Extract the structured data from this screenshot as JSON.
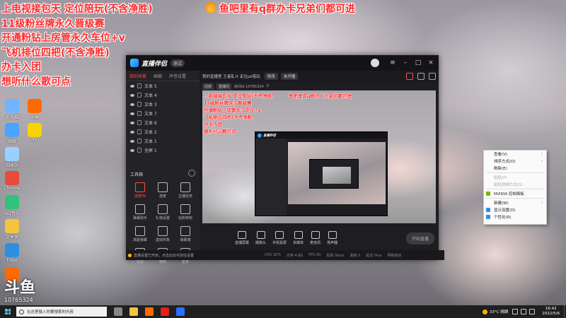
{
  "overlay": {
    "left_lines": [
      "上电视接包天 定位陪玩(不含净胜)",
      "11级粉丝牌永久晋级赛",
      "开通粉钻上房管永久车位+v",
      "飞机排位四把(不含净胜)",
      "办卡入团",
      "想听什么歌可点"
    ],
    "right_line": "鱼吧里有q群办卡兄弟们都可进"
  },
  "desktop_icons": [
    {
      "label": "此电脑",
      "color": "#6fb4ff"
    },
    {
      "label": "网络",
      "color": "#4aa3ff"
    },
    {
      "label": "回收站",
      "color": "#9ad0ff"
    },
    {
      "label": "Chrome",
      "color": "#e84b3c"
    },
    {
      "label": "QQ音乐",
      "color": "#31c27c"
    },
    {
      "label": "文件夹",
      "color": "#f5c342"
    },
    {
      "label": "Edge",
      "color": "#2f8ee0"
    },
    {
      "label": "直播",
      "color": "#ff6a00"
    }
  ],
  "desktop_icons_right": [
    {
      "label": "斗鱼",
      "color": "#ff6a00"
    },
    {
      "label": "YY",
      "color": "#f7d300"
    }
  ],
  "logo_badge": {
    "big": "斗鱼",
    "number": "10765324"
  },
  "app": {
    "name": "直播伴侣",
    "version": "测试",
    "left_tabs": [
      "我的场景",
      "画面",
      "声音设置"
    ],
    "scenes": [
      "文本 5",
      "文本 4",
      "文本 3",
      "文本 7",
      "文本 6",
      "文本 2",
      "文本 1",
      "全屏 1"
    ],
    "tools_heading": "工具箱",
    "tools": [
      {
        "label": "连麦PK",
        "red": true
      },
      {
        "label": "连麦",
        "red": false
      },
      {
        "label": "主播任务",
        "red": false
      },
      {
        "label": "弹幕助手",
        "red": false
      },
      {
        "label": "礼物设置",
        "red": false
      },
      {
        "label": "钻粉特权",
        "red": false
      },
      {
        "label": "高能弹幕",
        "red": false
      },
      {
        "label": "虚拟形象",
        "red": false
      },
      {
        "label": "弹幕墙",
        "red": false
      },
      {
        "label": "投屏",
        "red": false
      },
      {
        "label": "特效",
        "red": false
      },
      {
        "label": "更多",
        "red": false
      }
    ],
    "toolbar_title": "我的直播室 王者乱斗 定位pk陪玩",
    "toolbar_btn1": "修改",
    "toolbar_btn2": "未开播",
    "sub_btn1": "回放",
    "sub_btn2": "直播间",
    "sub_room": "房间id 10765324",
    "sub_count": "0",
    "preview_left_lines": [
      "上电视接包天 定位陪玩(不含净胜)",
      "11级粉丝牌永久晋级赛",
      "开通粉钻上房管永久车位+v",
      "飞机排位四把(不含净胜)",
      "办卡入团",
      "想听什么歌可点"
    ],
    "preview_right_line": "鱼吧里有q群办卡兄弟们都可进",
    "inner_name": "直播伴侣",
    "controls": [
      "直播屏幕",
      "摄像头",
      "手机投屏",
      "多媒体",
      "麦克风",
      "扬声器"
    ],
    "start_button": "开始直播",
    "notice": "直播设置已开启，点击此处可前往设置",
    "status": [
      "CPU 32%",
      "内存 4.8G",
      "FPS 60",
      "码率 0kb/s",
      "丢帧 0",
      "延迟 0ms",
      "网络良好"
    ]
  },
  "context_menu": {
    "items": [
      {
        "label": "查看(V)",
        "arrow": true,
        "disabled": false,
        "icon": ""
      },
      {
        "label": "排序方式(O)",
        "arrow": true,
        "disabled": false,
        "icon": ""
      },
      {
        "label": "刷新(E)",
        "arrow": false,
        "disabled": false,
        "icon": ""
      },
      {
        "label": "粘贴(P)",
        "arrow": false,
        "disabled": true,
        "icon": ""
      },
      {
        "label": "粘贴快捷方式(S)",
        "arrow": false,
        "disabled": true,
        "icon": ""
      },
      {
        "label": "NVIDIA 控制面板",
        "arrow": false,
        "disabled": false,
        "icon": "#76b900"
      },
      {
        "label": "新建(W)",
        "arrow": true,
        "disabled": false,
        "icon": ""
      },
      {
        "label": "显示设置(D)",
        "arrow": false,
        "disabled": false,
        "icon": "#2f8ee0"
      },
      {
        "label": "个性化(R)",
        "arrow": false,
        "disabled": false,
        "icon": "#2f8ee0"
      }
    ]
  },
  "taskbar": {
    "search_placeholder": "在这里输入你要搜索的内容",
    "apps": [
      {
        "name": "task-view",
        "color": "#888888"
      },
      {
        "name": "explorer",
        "color": "#f5c342"
      },
      {
        "name": "douyu",
        "color": "#ff6a00"
      },
      {
        "name": "netease-music",
        "color": "#e02020"
      },
      {
        "name": "live-companion",
        "color": "#2a6fff"
      }
    ],
    "weather": "33°C 晴朗",
    "time": "16:42",
    "date": "2022/5/6"
  }
}
